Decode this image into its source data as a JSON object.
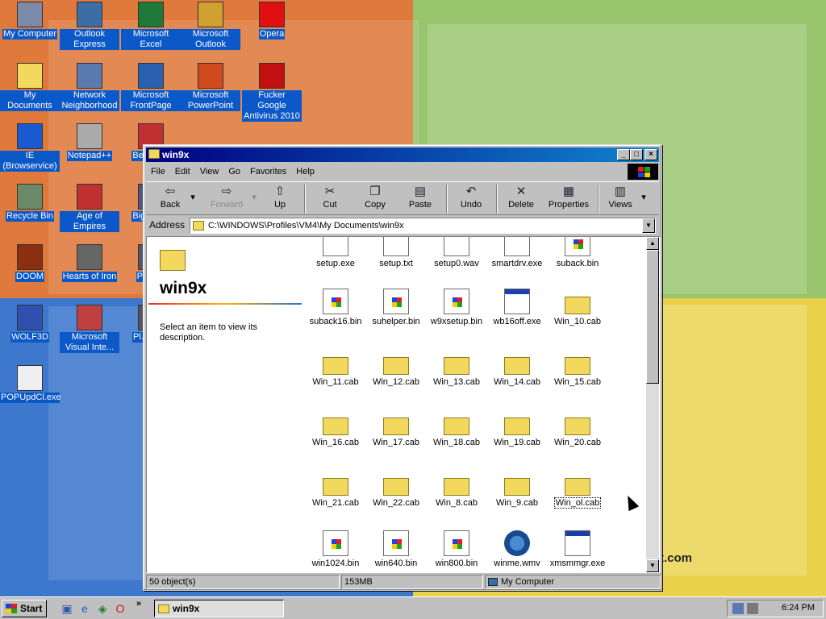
{
  "desktop": {
    "icons": [
      {
        "label": "My Computer",
        "icon": "computer-icon"
      },
      {
        "label": "Outlook Express",
        "icon": "outlook-express-icon"
      },
      {
        "label": "Microsoft Excel",
        "icon": "excel-icon"
      },
      {
        "label": "Microsoft Outlook",
        "icon": "outlook-icon"
      },
      {
        "label": "Opera",
        "icon": "opera-icon"
      },
      {
        "label": "My Documents",
        "icon": "folder-icon"
      },
      {
        "label": "Network Neighborhood",
        "icon": "network-icon"
      },
      {
        "label": "Microsoft FrontPage",
        "icon": "frontpage-icon"
      },
      {
        "label": "Microsoft PowerPoint",
        "icon": "powerpoint-icon"
      },
      {
        "label": "Fucker Google Antivirus 2010",
        "icon": "antivirus-icon"
      },
      {
        "label": "IE (Browservice)",
        "icon": "ie-icon"
      },
      {
        "label": "Notepad++",
        "icon": "notepad-icon"
      },
      {
        "label": "Bel... D...",
        "icon": "app-icon"
      },
      {
        "label": "Recycle Bin",
        "icon": "recycle-bin-icon"
      },
      {
        "label": "Age of Empires",
        "icon": "game-icon"
      },
      {
        "label": "Big... D...",
        "icon": "app-icon"
      },
      {
        "label": "DOOM",
        "icon": "doom-icon"
      },
      {
        "label": "Hearts of Iron",
        "icon": "game-icon"
      },
      {
        "label": "Pagg...",
        "icon": "app-icon"
      },
      {
        "label": "WOLF3D",
        "icon": "wolf3d-icon"
      },
      {
        "label": "Microsoft Visual Inte...",
        "icon": "visual-studio-icon"
      },
      {
        "label": "Pl... Zo...",
        "icon": "app-icon"
      },
      {
        "label": "POPUpdCl.exe",
        "icon": "exe-icon"
      }
    ],
    "wallpaper_text": "t.com",
    "colors": {
      "orange": "#e0793c",
      "green": "#97c46c",
      "blue": "#3d78cc",
      "yellow": "#e9d24a"
    }
  },
  "window": {
    "title": "win9x",
    "menu": [
      "File",
      "Edit",
      "View",
      "Go",
      "Favorites",
      "Help"
    ],
    "toolbar": {
      "back": "Back",
      "forward": "Forward",
      "up": "Up",
      "cut": "Cut",
      "copy": "Copy",
      "paste": "Paste",
      "undo": "Undo",
      "delete": "Delete",
      "properties": "Properties",
      "views": "Views"
    },
    "address_label": "Address",
    "address_value": "C:\\WINDOWS\\Profiles\\VM4\\My Documents\\win9x",
    "left_pane": {
      "folder_title": "win9x",
      "description": "Select an item to view its description."
    },
    "files": [
      {
        "name": "setup.exe",
        "type": "exe"
      },
      {
        "name": "setup.txt",
        "type": "txt"
      },
      {
        "name": "setup0.wav",
        "type": "wav"
      },
      {
        "name": "smartdrv.exe",
        "type": "exe"
      },
      {
        "name": "suback.bin",
        "type": "bin"
      },
      {
        "name": "suback16.bin",
        "type": "bin"
      },
      {
        "name": "suhelper.bin",
        "type": "bin"
      },
      {
        "name": "w9xsetup.bin",
        "type": "bin"
      },
      {
        "name": "wb16off.exe",
        "type": "exe"
      },
      {
        "name": "Win_10.cab",
        "type": "cab"
      },
      {
        "name": "Win_11.cab",
        "type": "cab"
      },
      {
        "name": "Win_12.cab",
        "type": "cab"
      },
      {
        "name": "Win_13.cab",
        "type": "cab"
      },
      {
        "name": "Win_14.cab",
        "type": "cab"
      },
      {
        "name": "Win_15.cab",
        "type": "cab"
      },
      {
        "name": "Win_16.cab",
        "type": "cab"
      },
      {
        "name": "Win_17.cab",
        "type": "cab"
      },
      {
        "name": "Win_18.cab",
        "type": "cab"
      },
      {
        "name": "Win_19.cab",
        "type": "cab"
      },
      {
        "name": "Win_20.cab",
        "type": "cab"
      },
      {
        "name": "Win_21.cab",
        "type": "cab"
      },
      {
        "name": "Win_22.cab",
        "type": "cab"
      },
      {
        "name": "Win_8.cab",
        "type": "cab"
      },
      {
        "name": "Win_9.cab",
        "type": "cab"
      },
      {
        "name": "Win_ol.cab",
        "type": "cab",
        "focused": true
      },
      {
        "name": "win1024.bin",
        "type": "bin"
      },
      {
        "name": "win640.bin",
        "type": "bin"
      },
      {
        "name": "win800.bin",
        "type": "bin"
      },
      {
        "name": "winme.wmv",
        "type": "wmv"
      },
      {
        "name": "xmsmmgr.exe",
        "type": "exe"
      }
    ],
    "status": {
      "objects": "50 object(s)",
      "size": "153MB",
      "location": "My Computer"
    }
  },
  "taskbar": {
    "start_label": "Start",
    "quick_launch": [
      "desktop-icon",
      "ie-icon",
      "channels-icon",
      "opera-icon"
    ],
    "more": "»",
    "task_title": "win9x",
    "clock": "6:24 PM"
  }
}
